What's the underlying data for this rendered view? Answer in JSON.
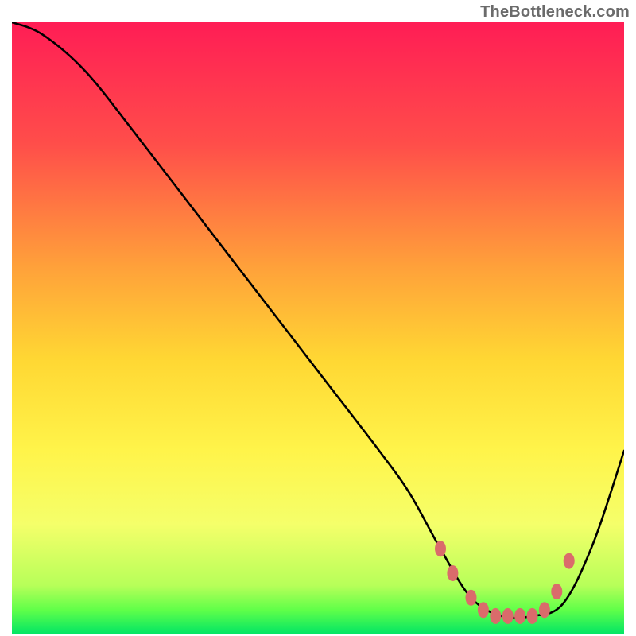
{
  "watermark": "TheBottleneck.com",
  "chart_data": {
    "type": "line",
    "title": "",
    "xlabel": "",
    "ylabel": "",
    "xlim": [
      0,
      100
    ],
    "ylim": [
      0,
      100
    ],
    "grid": false,
    "legend": false,
    "gradient_stops": [
      {
        "offset": 0,
        "color": "#ff1d55"
      },
      {
        "offset": 20,
        "color": "#ff4e4a"
      },
      {
        "offset": 40,
        "color": "#ffa13a"
      },
      {
        "offset": 55,
        "color": "#ffd733"
      },
      {
        "offset": 70,
        "color": "#fff44a"
      },
      {
        "offset": 82,
        "color": "#f5ff6a"
      },
      {
        "offset": 92,
        "color": "#b7ff59"
      },
      {
        "offset": 96,
        "color": "#60ff49"
      },
      {
        "offset": 100,
        "color": "#00e565"
      }
    ],
    "series": [
      {
        "name": "curve",
        "x": [
          0,
          5,
          12,
          20,
          30,
          40,
          50,
          60,
          65,
          70,
          75,
          80,
          85,
          90,
          95,
          100
        ],
        "values": [
          100,
          98,
          92,
          82,
          69,
          56,
          43,
          30,
          23,
          14,
          6,
          3,
          3,
          5,
          15,
          30
        ]
      }
    ],
    "markers": {
      "color": "#da6b6b",
      "points": [
        {
          "x": 70,
          "y": 14
        },
        {
          "x": 72,
          "y": 10
        },
        {
          "x": 75,
          "y": 6
        },
        {
          "x": 77,
          "y": 4
        },
        {
          "x": 79,
          "y": 3
        },
        {
          "x": 81,
          "y": 3
        },
        {
          "x": 83,
          "y": 3
        },
        {
          "x": 85,
          "y": 3
        },
        {
          "x": 87,
          "y": 4
        },
        {
          "x": 89,
          "y": 7
        },
        {
          "x": 91,
          "y": 12
        }
      ]
    }
  }
}
